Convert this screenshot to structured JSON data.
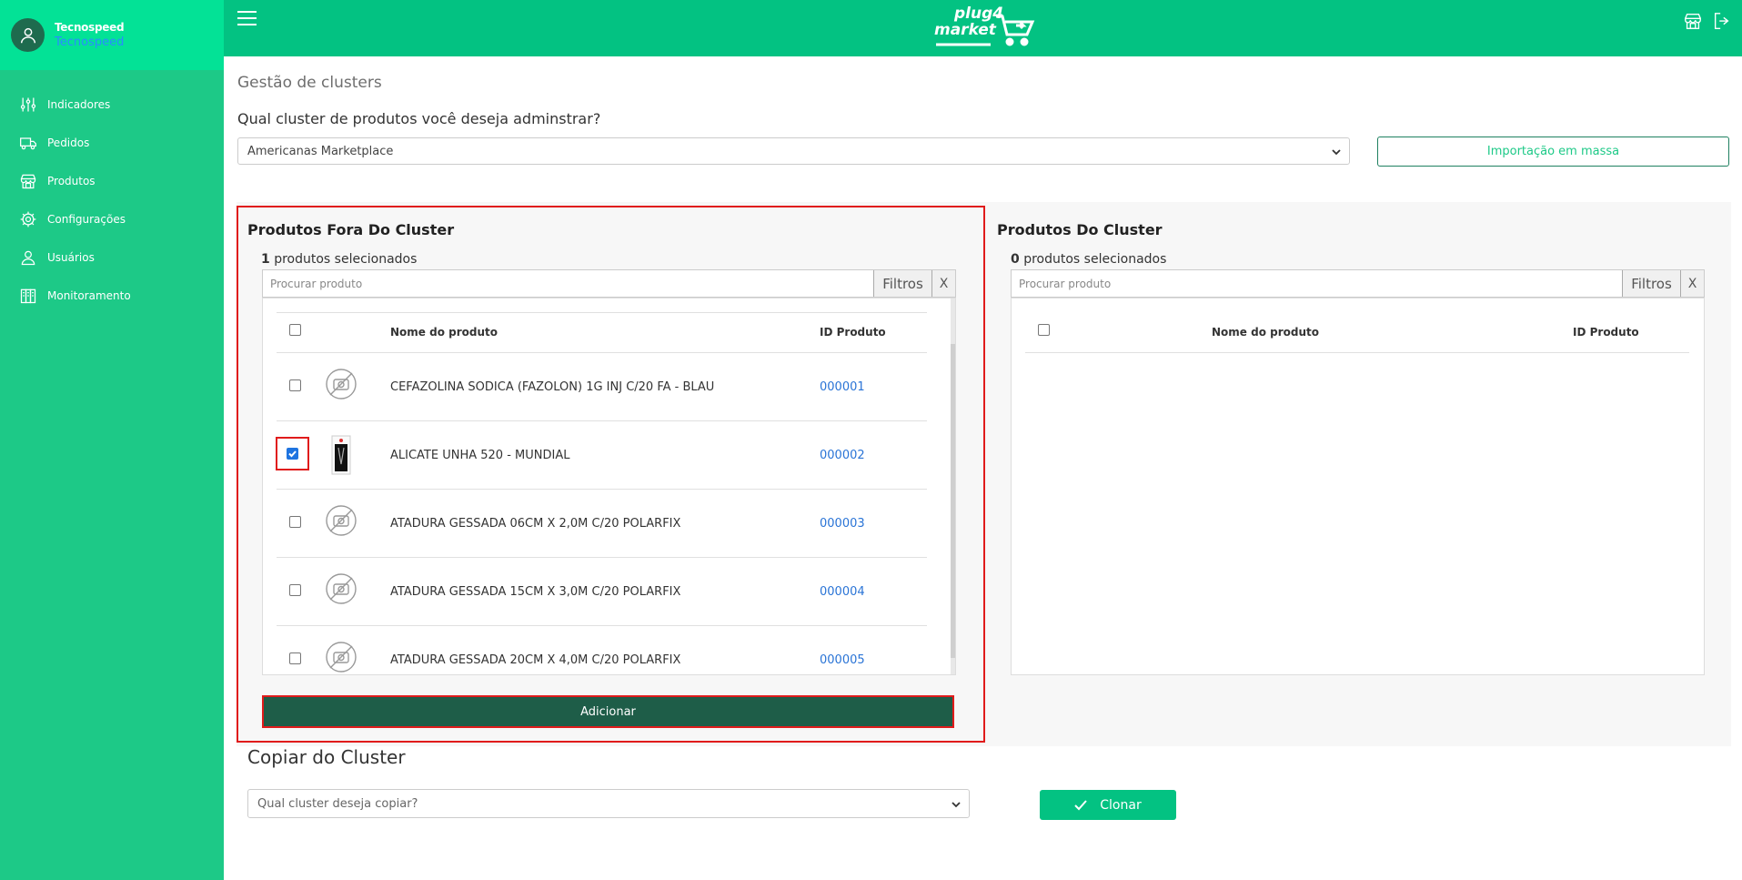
{
  "sidebar": {
    "user_name": "Tecnospeed",
    "user_company": "Tecnospeed",
    "items": [
      {
        "label": "Indicadores",
        "icon": "sliders-icon"
      },
      {
        "label": "Pedidos",
        "icon": "truck-icon"
      },
      {
        "label": "Produtos",
        "icon": "store-icon"
      },
      {
        "label": "Configurações",
        "icon": "gear-icon"
      },
      {
        "label": "Usuários",
        "icon": "user-icon"
      },
      {
        "label": "Monitoramento",
        "icon": "building-icon"
      }
    ]
  },
  "topbar": {
    "logo_line1": "plug4",
    "logo_line2": "market"
  },
  "main": {
    "page_title": "Gestão de clusters",
    "question": "Qual cluster de produtos você deseja adminstrar?",
    "cluster_select_value": "Americanas Marketplace",
    "import_button": "Importação em massa"
  },
  "left_panel": {
    "title": "Produtos Fora Do Cluster",
    "selected_count": "1",
    "selected_label": " produtos selecionados",
    "search_placeholder": "Procurar produto",
    "filtros_label": "Filtros",
    "clear_label": "X",
    "col_name": "Nome do produto",
    "col_id": "ID Produto",
    "rows": [
      {
        "name": "CEFAZOLINA SODICA (FAZOLON) 1G INJ C/20 FA - BLAU",
        "id": "000001",
        "checked": false,
        "has_image": false
      },
      {
        "name": "ALICATE UNHA 520 - MUNDIAL",
        "id": "000002",
        "checked": true,
        "has_image": true
      },
      {
        "name": "ATADURA GESSADA 06CM X 2,0M C/20 POLARFIX",
        "id": "000003",
        "checked": false,
        "has_image": false
      },
      {
        "name": "ATADURA GESSADA 15CM X 3,0M C/20 POLARFIX",
        "id": "000004",
        "checked": false,
        "has_image": false
      },
      {
        "name": "ATADURA GESSADA 20CM X 4,0M C/20 POLARFIX",
        "id": "000005",
        "checked": false,
        "has_image": false
      }
    ],
    "add_button": "Adicionar"
  },
  "right_panel": {
    "title": "Produtos Do Cluster",
    "selected_count": "0",
    "selected_label": " produtos selecionados",
    "search_placeholder": "Procurar produto",
    "filtros_label": "Filtros",
    "clear_label": "X",
    "col_name": "Nome do produto",
    "col_id": "ID Produto"
  },
  "copy": {
    "title": "Copiar do Cluster",
    "select_placeholder": "Qual cluster deseja copiar?",
    "clone_button": "Clonar"
  },
  "colors": {
    "sidebar": "#1dc987",
    "topbar": "#03c282",
    "add_button": "#1e5d48",
    "highlight": "#e01b1b",
    "link": "#2a74d6"
  }
}
